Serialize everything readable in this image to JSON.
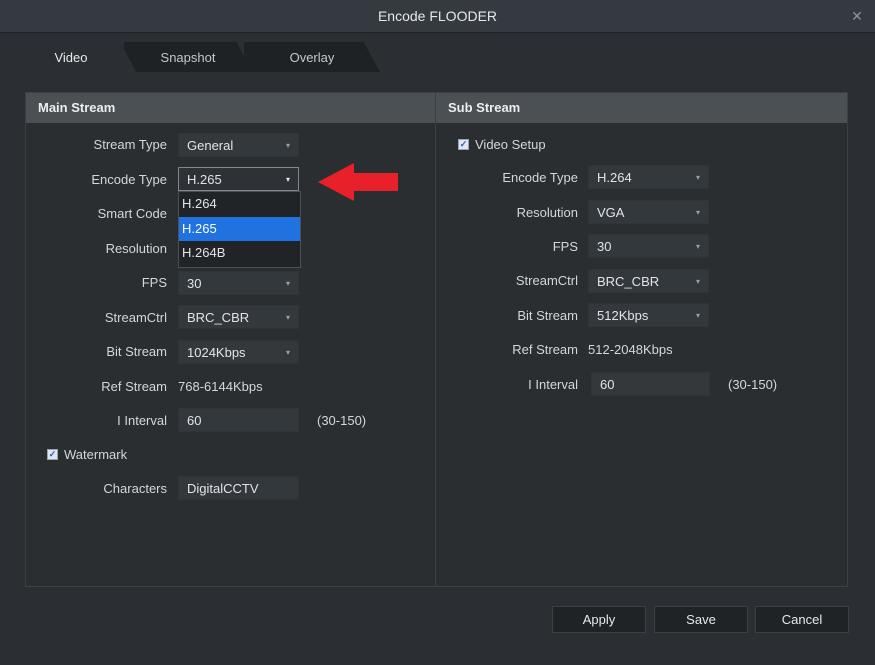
{
  "window": {
    "title": "Encode FLOODER",
    "close_glyph": "✕"
  },
  "tabs": [
    {
      "label": "Video"
    },
    {
      "label": "Snapshot"
    },
    {
      "label": "Overlay"
    }
  ],
  "main_stream": {
    "header": "Main Stream",
    "stream_type": {
      "label": "Stream Type",
      "value": "General"
    },
    "encode_type": {
      "label": "Encode Type",
      "value": "H.265",
      "options": [
        {
          "label": "H.264"
        },
        {
          "label": "H.265"
        },
        {
          "label": "H.264B"
        }
      ],
      "selected_option": "H.265"
    },
    "smart_code": {
      "label": "Smart Code"
    },
    "resolution": {
      "label": "Resolution"
    },
    "fps": {
      "label": "FPS",
      "value": "30"
    },
    "stream_ctrl": {
      "label": "StreamCtrl",
      "value": "BRC_CBR"
    },
    "bit_stream": {
      "label": "Bit Stream",
      "value": "1024Kbps"
    },
    "ref_stream": {
      "label": "Ref Stream",
      "value": "768-6144Kbps"
    },
    "i_interval": {
      "label": "I Interval",
      "value": "60",
      "range": "(30-150)"
    },
    "watermark": {
      "label": "Watermark",
      "checked": true
    },
    "characters": {
      "label": "Characters",
      "value": "DigitalCCTV"
    }
  },
  "sub_stream": {
    "header": "Sub Stream",
    "video_setup": {
      "label": "Video Setup",
      "checked": true
    },
    "encode_type": {
      "label": "Encode Type",
      "value": "H.264"
    },
    "resolution": {
      "label": "Resolution",
      "value": "VGA"
    },
    "fps": {
      "label": "FPS",
      "value": "30"
    },
    "stream_ctrl": {
      "label": "StreamCtrl",
      "value": "BRC_CBR"
    },
    "bit_stream": {
      "label": "Bit Stream",
      "value": "512Kbps"
    },
    "ref_stream": {
      "label": "Ref Stream",
      "value": "512-2048Kbps"
    },
    "i_interval": {
      "label": "I Interval",
      "value": "60",
      "range": "(30-150)"
    }
  },
  "buttons": {
    "apply": "Apply",
    "save": "Save",
    "cancel": "Cancel"
  },
  "icons": {
    "caret": "▾",
    "check": "✓"
  },
  "colors": {
    "annotation_arrow": "#e8202a",
    "selected_option": "#1f72e0"
  }
}
